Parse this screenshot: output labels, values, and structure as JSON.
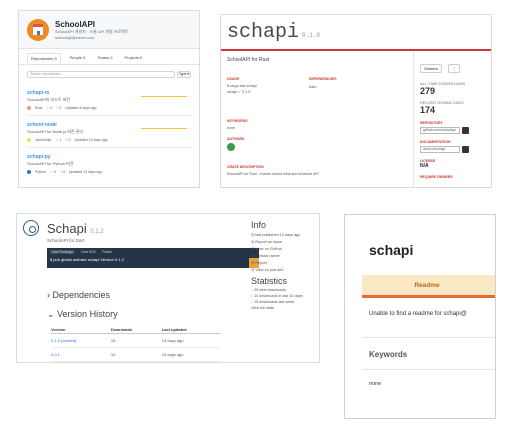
{
  "github": {
    "org_name": "SchoolAPI",
    "org_desc": "SchoolAPI 개발자 · 스쿨 API 개발 프로젝트",
    "org_email": "schoolapi@naver.com",
    "tabs": [
      {
        "label": "Repositories 9"
      },
      {
        "label": "People 0"
      },
      {
        "label": "Teams 0"
      },
      {
        "label": "Projects 0"
      }
    ],
    "search_placeholder": "Search repositories...",
    "type_button": "Type ▾",
    "repos": [
      {
        "name": "schapi-rs",
        "desc": "SchoolAPI의 러스트 버전",
        "meta": [
          "Rust",
          "☆ 0",
          "⑂ 0",
          "Updated 4 days ago"
        ],
        "lang_color": "#dea584"
      },
      {
        "name": "school-node",
        "desc": "SchoolAPI for Node.js 버전 관리",
        "meta": [
          "JavaScript",
          "☆ 1",
          "⑂ 0",
          "Updated 13 days ago"
        ],
        "lang_color": "#f1e05a"
      },
      {
        "name": "schapi-py",
        "desc": "SchoolAPI for Python 버전",
        "meta": [
          "Python",
          "☆ 0",
          "⑂ 0",
          "Updated 13 days ago"
        ],
        "lang_color": "#3572A5"
      }
    ]
  },
  "npm": {
    "title": "schapi",
    "version": "0.1.0",
    "desc": "SchoolAPI for Rust",
    "sections": {
      "usage": "USAGE",
      "usage_lines": [
        "$ cargo add schapi",
        "schapi = \"0.1.0\""
      ],
      "keywords": "KEYWORDS",
      "keywords_val": "none",
      "authors": "AUTHORS",
      "license": "LICENSE",
      "deps": "DEPENDENCIES",
      "deps_val": "tokio",
      "top": "CRATE DESCRIPTION",
      "top_val": "SchoolAPI for Rust - Korean school meal and schedule API"
    },
    "side": {
      "btn1": "Owners",
      "btn2": "⋮",
      "downloads_label": "ALL-TIME DOWNLOADS",
      "downloads": "279",
      "recent_label": "RECENT DOWNLOADS",
      "recent": "174",
      "repo_label": "REPOSITORY",
      "repo_val": "github.com/schoolapi",
      "docs_label": "DOCUMENTATION",
      "docs_val": "docs.rs/schapi",
      "license_label": "LICENSE",
      "license_val": "N/A",
      "owner_label": "REQUIRE OWNERS"
    }
  },
  "hackage": {
    "title": "Schapi",
    "version": "0.1.2",
    "desc": "SchoolAPI for Dart",
    "dark_tabs": [
      "Dart Package",
      "Dart SDK",
      "Flutter"
    ],
    "install_cmd": "$ pub global activate schapi  Version 0.1.2",
    "dependencies": "Dependencies",
    "version_history": "Version History",
    "table_headers": [
      "Version",
      "Downloads",
      "Last updated"
    ],
    "table_rows": [
      [
        "0.1.2 (current)",
        "15",
        "13 days ago"
      ],
      [
        "0.0.1",
        "10",
        "13 days ago"
      ]
    ],
    "info_title": "Info",
    "info_lines": [
      "◎ last published 13 days ago",
      "◎ Report an issue",
      "◎ View on GitHub",
      "◎ Contact owner",
      "◎ Report",
      "◎ View on pub.dev"
    ],
    "stats_title": "Statistics",
    "stats_lines": [
      "↓ 25 total downloads",
      "↓ 10 downloads in last 30 days",
      "↓ 15 downloads last week",
      "View full stats"
    ]
  },
  "docs": {
    "title": "schapi",
    "tab": "Readme",
    "message": "Unable to find a readme for schapi@",
    "keywords_heading": "Keywords",
    "keywords_value": "none"
  }
}
